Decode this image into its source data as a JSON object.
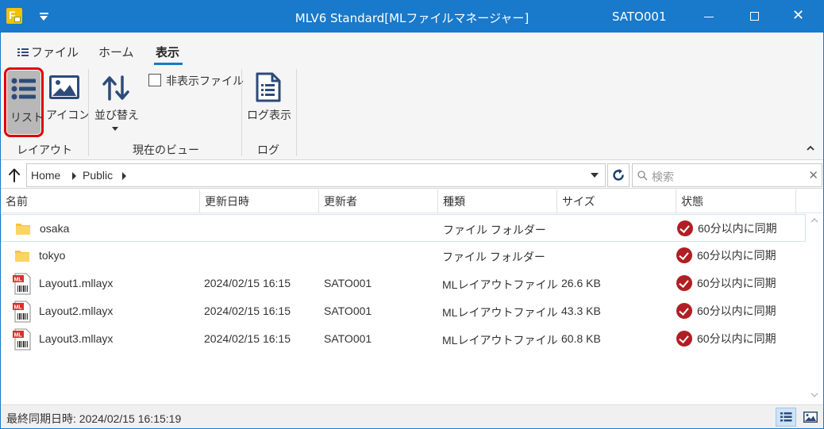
{
  "window": {
    "title": "MLV6 Standard[MLファイルマネージャー]",
    "user": "SATO001",
    "accent": "#1979ca"
  },
  "ribbon": {
    "tabs": [
      {
        "label": "ファイル",
        "icon": "list-icon"
      },
      {
        "label": "ホーム"
      },
      {
        "label": "表示",
        "active": true
      }
    ],
    "groups": {
      "layout": {
        "label": "レイアウト",
        "list_label": "リスト",
        "icon_label": "アイコン"
      },
      "current_view": {
        "label": "現在のビュー",
        "sort_label": "並び替え",
        "hidden_files_label": "非表示ファイル",
        "hidden_files_checked": false
      },
      "log": {
        "label": "ログ",
        "log_view_label": "ログ表示"
      }
    }
  },
  "address": {
    "crumbs": [
      "Home",
      "Public"
    ],
    "search_placeholder": "検索"
  },
  "table": {
    "columns": [
      "名前",
      "更新日時",
      "更新者",
      "種類",
      "サイズ",
      "状態"
    ],
    "rows": [
      {
        "name": "osaka",
        "modified": "",
        "author": "",
        "type": "ファイル フォルダー",
        "size": "",
        "status": "60分以内に同期",
        "icon": "folder-icon"
      },
      {
        "name": "tokyo",
        "modified": "",
        "author": "",
        "type": "ファイル フォルダー",
        "size": "",
        "status": "60分以内に同期",
        "icon": "folder-icon"
      },
      {
        "name": "Layout1.mllayx",
        "modified": "2024/02/15 16:15",
        "author": "SATO001",
        "type": "MLレイアウトファイル",
        "size": "26.6 KB",
        "status": "60分以内に同期",
        "icon": "ml-layout-file-icon"
      },
      {
        "name": "Layout2.mllayx",
        "modified": "2024/02/15 16:15",
        "author": "SATO001",
        "type": "MLレイアウトファイル",
        "size": "43.3 KB",
        "status": "60分以内に同期",
        "icon": "ml-layout-file-icon"
      },
      {
        "name": "Layout3.mllayx",
        "modified": "2024/02/15 16:15",
        "author": "SATO001",
        "type": "MLレイアウトファイル",
        "size": "60.8 KB",
        "status": "60分以内に同期",
        "icon": "ml-layout-file-icon"
      }
    ]
  },
  "statusbar": {
    "last_sync": "最終同期日時: 2024/02/15 16:15:19"
  }
}
